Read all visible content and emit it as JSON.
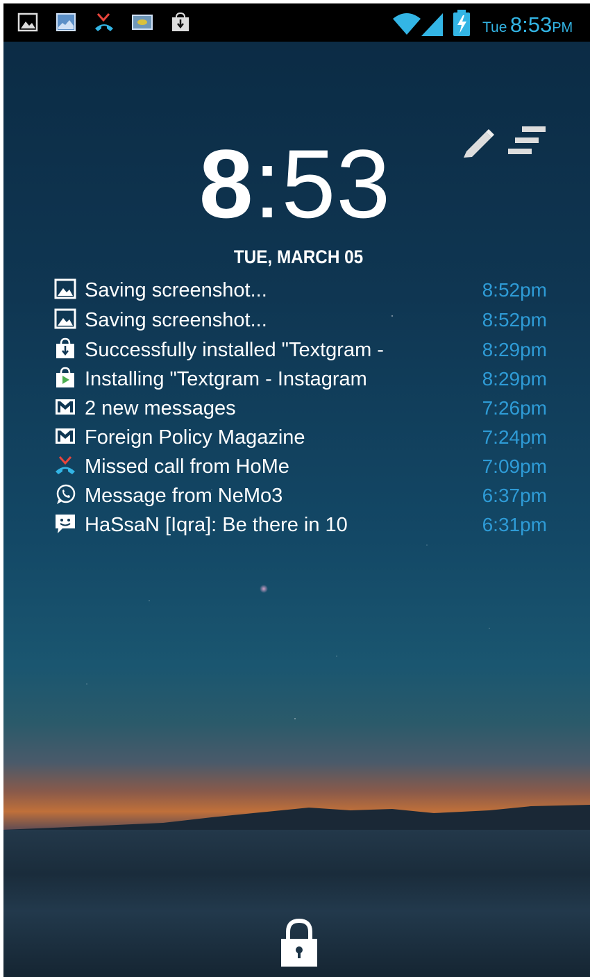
{
  "status_bar": {
    "icons": [
      "image-icon",
      "gallery-icon",
      "missed-call-icon",
      "screenshot-icon",
      "download-bag-icon",
      "wifi-icon",
      "signal-icon",
      "battery-charging-icon"
    ],
    "day": "Tue",
    "time": "8:53",
    "ampm": "PM",
    "accent_color": "#33b5e5"
  },
  "lockscreen": {
    "clock_hour": "8",
    "clock_sep": ":",
    "clock_minutes": "53",
    "date": "TUE, MARCH 05",
    "tool_icons": [
      "pencil-icon",
      "list-icon"
    ],
    "lock_icon": "lock-icon"
  },
  "notifications": [
    {
      "icon": "image-icon",
      "text": "Saving screenshot...",
      "time": "8:52pm"
    },
    {
      "icon": "image-icon",
      "text": "Saving screenshot...",
      "time": "8:52pm"
    },
    {
      "icon": "download-bag-icon",
      "text": "Successfully installed \"Textgram -",
      "time": "8:29pm"
    },
    {
      "icon": "play-store-icon",
      "text": "Installing \"Textgram - Instagram",
      "time": "8:29pm"
    },
    {
      "icon": "gmail-icon",
      "text": "2 new messages",
      "time": "7:26pm"
    },
    {
      "icon": "gmail-icon",
      "text": "Foreign Policy Magazine",
      "time": "7:24pm"
    },
    {
      "icon": "missed-call-icon",
      "text": "Missed call from HoMe",
      "time": "7:09pm"
    },
    {
      "icon": "whatsapp-icon",
      "text": "Message from NeMo3",
      "time": "6:37pm"
    },
    {
      "icon": "chat-icon",
      "text": "HaSsaN [Iqra]: Be there in 10",
      "time": "6:31pm"
    }
  ]
}
